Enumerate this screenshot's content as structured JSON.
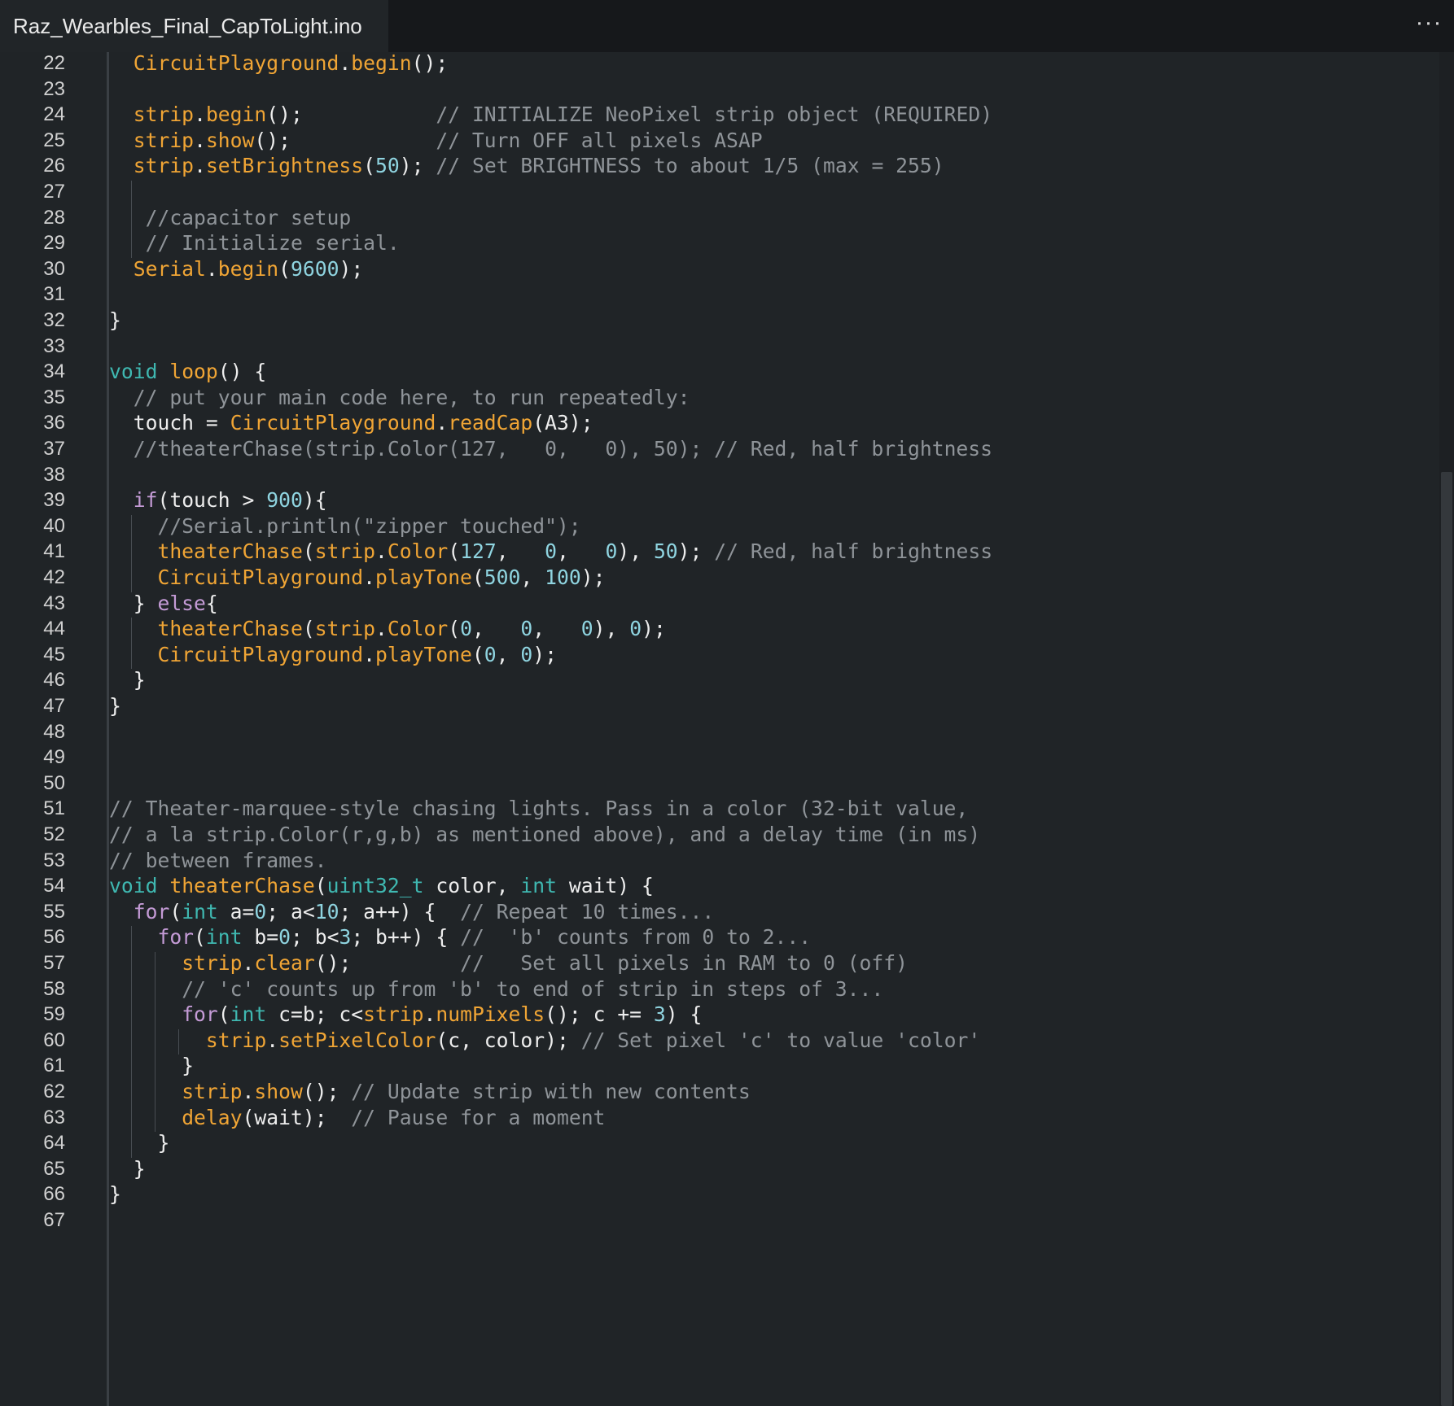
{
  "tab": {
    "title": "Raz_Wearbles_Final_CapToLight.ino"
  },
  "more_label": "···",
  "colors": {
    "comment": "#8f9499",
    "keyword": "#c49bd6",
    "type": "#3fb8b1",
    "class": "#f0a535",
    "func": "#f0a535",
    "number": "#8fd4e0",
    "plain": "#ededed"
  },
  "code": [
    {
      "num": "22",
      "tokens": [
        {
          "t": "  ",
          "k": "plain"
        },
        {
          "t": "CircuitPlayground",
          "k": "class"
        },
        {
          "t": ".",
          "k": "plain"
        },
        {
          "t": "begin",
          "k": "func"
        },
        {
          "t": "();",
          "k": "plain"
        }
      ]
    },
    {
      "num": "23",
      "tokens": []
    },
    {
      "num": "24",
      "tokens": [
        {
          "t": "  ",
          "k": "plain"
        },
        {
          "t": "strip",
          "k": "class"
        },
        {
          "t": ".",
          "k": "plain"
        },
        {
          "t": "begin",
          "k": "func"
        },
        {
          "t": "();           ",
          "k": "plain"
        },
        {
          "t": "// INITIALIZE NeoPixel strip object (REQUIRED)",
          "k": "comment"
        }
      ]
    },
    {
      "num": "25",
      "tokens": [
        {
          "t": "  ",
          "k": "plain"
        },
        {
          "t": "strip",
          "k": "class"
        },
        {
          "t": ".",
          "k": "plain"
        },
        {
          "t": "show",
          "k": "func"
        },
        {
          "t": "();            ",
          "k": "plain"
        },
        {
          "t": "// Turn OFF all pixels ASAP",
          "k": "comment"
        }
      ]
    },
    {
      "num": "26",
      "tokens": [
        {
          "t": "  ",
          "k": "plain"
        },
        {
          "t": "strip",
          "k": "class"
        },
        {
          "t": ".",
          "k": "plain"
        },
        {
          "t": "setBrightness",
          "k": "func"
        },
        {
          "t": "(",
          "k": "plain"
        },
        {
          "t": "50",
          "k": "number"
        },
        {
          "t": "); ",
          "k": "plain"
        },
        {
          "t": "// Set BRIGHTNESS to about 1/5 (max = 255)",
          "k": "comment"
        }
      ]
    },
    {
      "num": "27",
      "tokens": []
    },
    {
      "num": "28",
      "tokens": [
        {
          "t": "   ",
          "k": "plain"
        },
        {
          "t": "//capacitor setup",
          "k": "comment"
        }
      ]
    },
    {
      "num": "29",
      "tokens": [
        {
          "t": "   ",
          "k": "plain"
        },
        {
          "t": "// Initialize serial.",
          "k": "comment"
        }
      ]
    },
    {
      "num": "30",
      "tokens": [
        {
          "t": "  ",
          "k": "plain"
        },
        {
          "t": "Serial",
          "k": "class"
        },
        {
          "t": ".",
          "k": "plain"
        },
        {
          "t": "begin",
          "k": "func"
        },
        {
          "t": "(",
          "k": "plain"
        },
        {
          "t": "9600",
          "k": "number"
        },
        {
          "t": ");",
          "k": "plain"
        }
      ]
    },
    {
      "num": "31",
      "tokens": []
    },
    {
      "num": "32",
      "tokens": [
        {
          "t": "}",
          "k": "plain"
        }
      ]
    },
    {
      "num": "33",
      "tokens": []
    },
    {
      "num": "34",
      "tokens": [
        {
          "t": "void",
          "k": "type"
        },
        {
          "t": " ",
          "k": "plain"
        },
        {
          "t": "loop",
          "k": "func"
        },
        {
          "t": "() {",
          "k": "plain"
        }
      ]
    },
    {
      "num": "35",
      "tokens": [
        {
          "t": "  ",
          "k": "plain"
        },
        {
          "t": "// put your main code here, to run repeatedly:",
          "k": "comment"
        }
      ]
    },
    {
      "num": "36",
      "tokens": [
        {
          "t": "  touch = ",
          "k": "plain"
        },
        {
          "t": "CircuitPlayground",
          "k": "class"
        },
        {
          "t": ".",
          "k": "plain"
        },
        {
          "t": "readCap",
          "k": "func"
        },
        {
          "t": "(A3);",
          "k": "plain"
        }
      ]
    },
    {
      "num": "37",
      "tokens": [
        {
          "t": "  ",
          "k": "plain"
        },
        {
          "t": "//theaterChase(strip.Color(127,   0,   0), 50); // Red, half brightness",
          "k": "comment"
        }
      ]
    },
    {
      "num": "38",
      "tokens": []
    },
    {
      "num": "39",
      "tokens": [
        {
          "t": "  ",
          "k": "plain"
        },
        {
          "t": "if",
          "k": "keyword"
        },
        {
          "t": "(touch > ",
          "k": "plain"
        },
        {
          "t": "900",
          "k": "number"
        },
        {
          "t": "){",
          "k": "plain"
        }
      ]
    },
    {
      "num": "40",
      "tokens": [
        {
          "t": "    ",
          "k": "plain"
        },
        {
          "t": "//Serial.println(\"zipper touched\");",
          "k": "comment"
        }
      ]
    },
    {
      "num": "41",
      "tokens": [
        {
          "t": "    ",
          "k": "plain"
        },
        {
          "t": "theaterChase",
          "k": "func"
        },
        {
          "t": "(",
          "k": "plain"
        },
        {
          "t": "strip",
          "k": "class"
        },
        {
          "t": ".",
          "k": "plain"
        },
        {
          "t": "Color",
          "k": "func"
        },
        {
          "t": "(",
          "k": "plain"
        },
        {
          "t": "127",
          "k": "number"
        },
        {
          "t": ",   ",
          "k": "plain"
        },
        {
          "t": "0",
          "k": "number"
        },
        {
          "t": ",   ",
          "k": "plain"
        },
        {
          "t": "0",
          "k": "number"
        },
        {
          "t": "), ",
          "k": "plain"
        },
        {
          "t": "50",
          "k": "number"
        },
        {
          "t": "); ",
          "k": "plain"
        },
        {
          "t": "// Red, half brightness",
          "k": "comment"
        }
      ]
    },
    {
      "num": "42",
      "tokens": [
        {
          "t": "    ",
          "k": "plain"
        },
        {
          "t": "CircuitPlayground",
          "k": "class"
        },
        {
          "t": ".",
          "k": "plain"
        },
        {
          "t": "playTone",
          "k": "func"
        },
        {
          "t": "(",
          "k": "plain"
        },
        {
          "t": "500",
          "k": "number"
        },
        {
          "t": ", ",
          "k": "plain"
        },
        {
          "t": "100",
          "k": "number"
        },
        {
          "t": ");",
          "k": "plain"
        }
      ]
    },
    {
      "num": "43",
      "tokens": [
        {
          "t": "  } ",
          "k": "plain"
        },
        {
          "t": "else",
          "k": "keyword"
        },
        {
          "t": "{",
          "k": "plain"
        }
      ]
    },
    {
      "num": "44",
      "tokens": [
        {
          "t": "    ",
          "k": "plain"
        },
        {
          "t": "theaterChase",
          "k": "func"
        },
        {
          "t": "(",
          "k": "plain"
        },
        {
          "t": "strip",
          "k": "class"
        },
        {
          "t": ".",
          "k": "plain"
        },
        {
          "t": "Color",
          "k": "func"
        },
        {
          "t": "(",
          "k": "plain"
        },
        {
          "t": "0",
          "k": "number"
        },
        {
          "t": ",   ",
          "k": "plain"
        },
        {
          "t": "0",
          "k": "number"
        },
        {
          "t": ",   ",
          "k": "plain"
        },
        {
          "t": "0",
          "k": "number"
        },
        {
          "t": "), ",
          "k": "plain"
        },
        {
          "t": "0",
          "k": "number"
        },
        {
          "t": ");",
          "k": "plain"
        }
      ]
    },
    {
      "num": "45",
      "tokens": [
        {
          "t": "    ",
          "k": "plain"
        },
        {
          "t": "CircuitPlayground",
          "k": "class"
        },
        {
          "t": ".",
          "k": "plain"
        },
        {
          "t": "playTone",
          "k": "func"
        },
        {
          "t": "(",
          "k": "plain"
        },
        {
          "t": "0",
          "k": "number"
        },
        {
          "t": ", ",
          "k": "plain"
        },
        {
          "t": "0",
          "k": "number"
        },
        {
          "t": ");",
          "k": "plain"
        }
      ]
    },
    {
      "num": "46",
      "tokens": [
        {
          "t": "  }",
          "k": "plain"
        }
      ]
    },
    {
      "num": "47",
      "tokens": [
        {
          "t": "}",
          "k": "plain"
        }
      ]
    },
    {
      "num": "48",
      "tokens": []
    },
    {
      "num": "49",
      "tokens": []
    },
    {
      "num": "50",
      "tokens": []
    },
    {
      "num": "51",
      "tokens": [
        {
          "t": "// Theater-marquee-style chasing lights. Pass in a color (32-bit value,",
          "k": "comment"
        }
      ]
    },
    {
      "num": "52",
      "tokens": [
        {
          "t": "// a la strip.Color(r,g,b) as mentioned above), and a delay time (in ms)",
          "k": "comment"
        }
      ]
    },
    {
      "num": "53",
      "tokens": [
        {
          "t": "// between frames.",
          "k": "comment"
        }
      ]
    },
    {
      "num": "54",
      "tokens": [
        {
          "t": "void",
          "k": "type"
        },
        {
          "t": " ",
          "k": "plain"
        },
        {
          "t": "theaterChase",
          "k": "func"
        },
        {
          "t": "(",
          "k": "plain"
        },
        {
          "t": "uint32_t",
          "k": "type"
        },
        {
          "t": " color, ",
          "k": "plain"
        },
        {
          "t": "int",
          "k": "type"
        },
        {
          "t": " wait) {",
          "k": "plain"
        }
      ]
    },
    {
      "num": "55",
      "tokens": [
        {
          "t": "  ",
          "k": "plain"
        },
        {
          "t": "for",
          "k": "keyword"
        },
        {
          "t": "(",
          "k": "plain"
        },
        {
          "t": "int",
          "k": "type"
        },
        {
          "t": " a=",
          "k": "plain"
        },
        {
          "t": "0",
          "k": "number"
        },
        {
          "t": "; a<",
          "k": "plain"
        },
        {
          "t": "10",
          "k": "number"
        },
        {
          "t": "; a++) {  ",
          "k": "plain"
        },
        {
          "t": "// Repeat 10 times...",
          "k": "comment"
        }
      ]
    },
    {
      "num": "56",
      "tokens": [
        {
          "t": "    ",
          "k": "plain"
        },
        {
          "t": "for",
          "k": "keyword"
        },
        {
          "t": "(",
          "k": "plain"
        },
        {
          "t": "int",
          "k": "type"
        },
        {
          "t": " b=",
          "k": "plain"
        },
        {
          "t": "0",
          "k": "number"
        },
        {
          "t": "; b<",
          "k": "plain"
        },
        {
          "t": "3",
          "k": "number"
        },
        {
          "t": "; b++) { ",
          "k": "plain"
        },
        {
          "t": "//  'b' counts from 0 to 2...",
          "k": "comment"
        }
      ]
    },
    {
      "num": "57",
      "tokens": [
        {
          "t": "      ",
          "k": "plain"
        },
        {
          "t": "strip",
          "k": "class"
        },
        {
          "t": ".",
          "k": "plain"
        },
        {
          "t": "clear",
          "k": "func"
        },
        {
          "t": "();         ",
          "k": "plain"
        },
        {
          "t": "//   Set all pixels in RAM to 0 (off)",
          "k": "comment"
        }
      ]
    },
    {
      "num": "58",
      "tokens": [
        {
          "t": "      ",
          "k": "plain"
        },
        {
          "t": "// 'c' counts up from 'b' to end of strip in steps of 3...",
          "k": "comment"
        }
      ]
    },
    {
      "num": "59",
      "tokens": [
        {
          "t": "      ",
          "k": "plain"
        },
        {
          "t": "for",
          "k": "keyword"
        },
        {
          "t": "(",
          "k": "plain"
        },
        {
          "t": "int",
          "k": "type"
        },
        {
          "t": " c=b; c<",
          "k": "plain"
        },
        {
          "t": "strip",
          "k": "class"
        },
        {
          "t": ".",
          "k": "plain"
        },
        {
          "t": "numPixels",
          "k": "func"
        },
        {
          "t": "(); c += ",
          "k": "plain"
        },
        {
          "t": "3",
          "k": "number"
        },
        {
          "t": ") {",
          "k": "plain"
        }
      ]
    },
    {
      "num": "60",
      "tokens": [
        {
          "t": "        ",
          "k": "plain"
        },
        {
          "t": "strip",
          "k": "class"
        },
        {
          "t": ".",
          "k": "plain"
        },
        {
          "t": "setPixelColor",
          "k": "func"
        },
        {
          "t": "(c, color); ",
          "k": "plain"
        },
        {
          "t": "// Set pixel 'c' to value 'color'",
          "k": "comment"
        }
      ]
    },
    {
      "num": "61",
      "tokens": [
        {
          "t": "      }",
          "k": "plain"
        }
      ]
    },
    {
      "num": "62",
      "tokens": [
        {
          "t": "      ",
          "k": "plain"
        },
        {
          "t": "strip",
          "k": "class"
        },
        {
          "t": ".",
          "k": "plain"
        },
        {
          "t": "show",
          "k": "func"
        },
        {
          "t": "(); ",
          "k": "plain"
        },
        {
          "t": "// Update strip with new contents",
          "k": "comment"
        }
      ]
    },
    {
      "num": "63",
      "tokens": [
        {
          "t": "      ",
          "k": "plain"
        },
        {
          "t": "delay",
          "k": "func"
        },
        {
          "t": "(wait);  ",
          "k": "plain"
        },
        {
          "t": "// Pause for a moment",
          "k": "comment"
        }
      ]
    },
    {
      "num": "64",
      "tokens": [
        {
          "t": "    }",
          "k": "plain"
        }
      ]
    },
    {
      "num": "65",
      "tokens": [
        {
          "t": "  }",
          "k": "plain"
        }
      ]
    },
    {
      "num": "66",
      "tokens": [
        {
          "t": "}",
          "k": "plain"
        }
      ]
    },
    {
      "num": "67",
      "tokens": []
    }
  ]
}
